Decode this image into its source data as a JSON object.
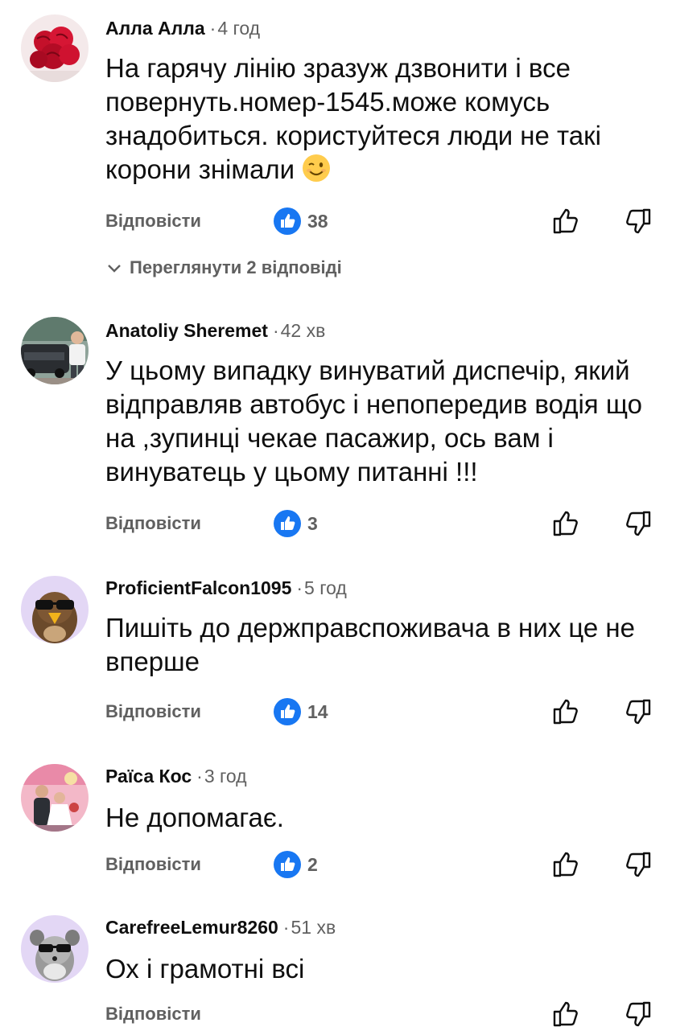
{
  "reply_label": "Відповісти",
  "colors": {
    "like_badge": "#1877f2",
    "secondary_text": "#606060",
    "primary_text": "#0f0f0f"
  },
  "icons": {
    "like_badge": "thumbs-up-badge-icon",
    "like": "thumb-up-outline-icon",
    "dislike": "thumb-down-outline-icon",
    "expand": "chevron-down-icon"
  },
  "comments": [
    {
      "author": "Алла Алла",
      "time": "4 год",
      "text": "На гарячу лінію зразуж дзвонити і все повернуть.номер-1545.може комусь знадобиться.  користуйтеся люди не такі корони знімали",
      "emoji": "winking-face-emoji",
      "likes": "38",
      "replies_label": "Переглянути 2 відповіді"
    },
    {
      "author": "Anatoliy Sheremet",
      "time": "42 хв",
      "text": "У цьому випадку винуватий диспечір, який відправляв автобус і непопередив водія що на ,зупинці чекае пасажир, ось вам і винуватець у цьому питанні !!!",
      "likes": "3"
    },
    {
      "author": "ProficientFalcon1095",
      "time": "5 год",
      "text": "Пишіть до держправспоживача в них це не вперше",
      "likes": "14"
    },
    {
      "author": "Раїса Кос",
      "time": "3 год",
      "text": "Не допомагає.",
      "likes": "2"
    },
    {
      "author": "CarefreeLemur8260",
      "time": "51 хв",
      "text": "Ох і грамотні всі"
    }
  ]
}
